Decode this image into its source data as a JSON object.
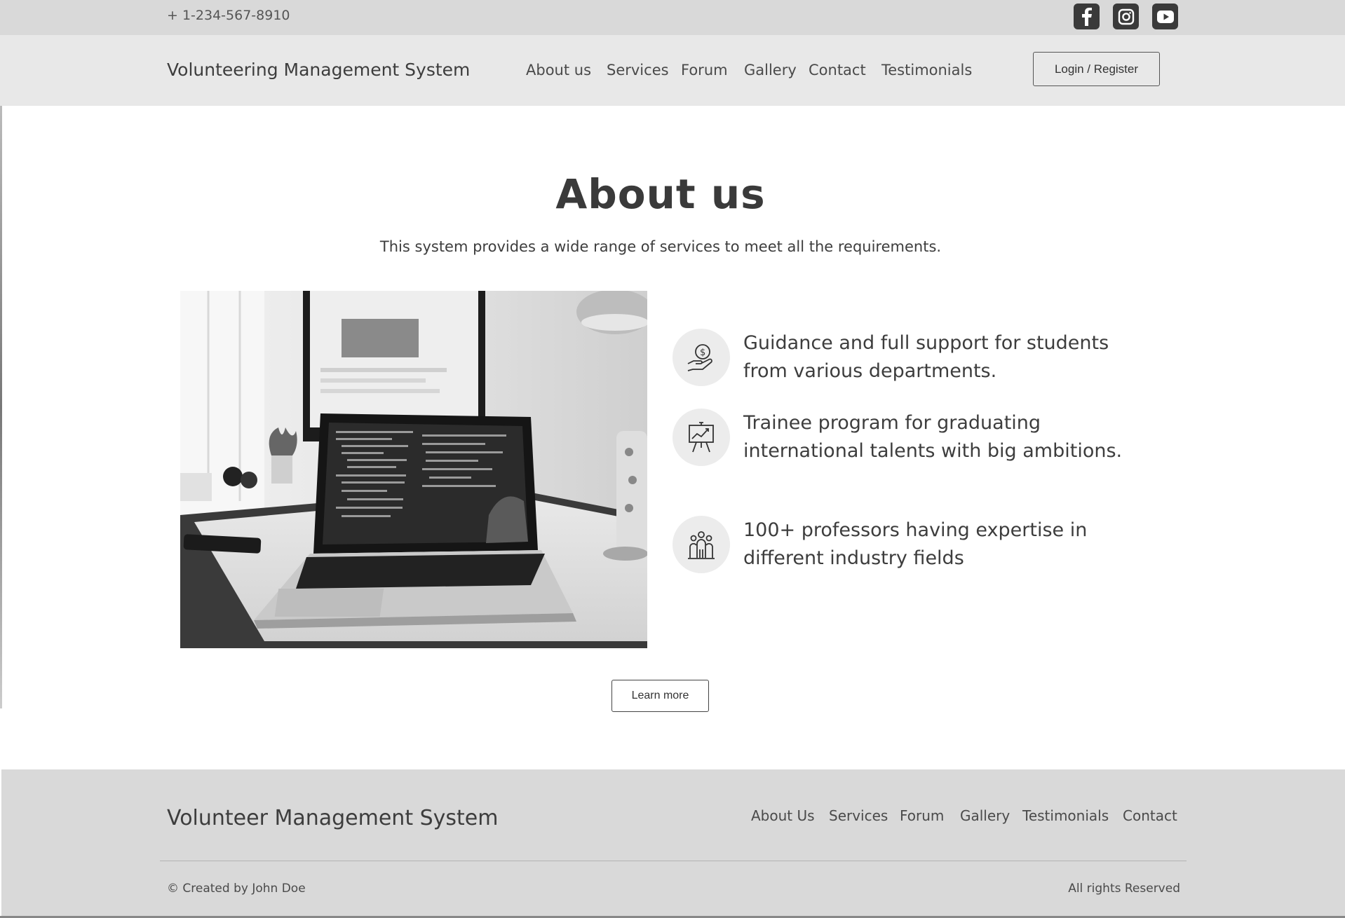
{
  "topbar": {
    "phone": "+ 1-234-567-8910",
    "social": [
      {
        "icon": "facebook-icon"
      },
      {
        "icon": "instagram-icon"
      },
      {
        "icon": "youtube-icon"
      }
    ]
  },
  "header": {
    "brand": "Volunteering Management System",
    "nav": [
      "About us",
      "Services",
      "Forum",
      "Gallery",
      "Contact",
      "Testimonials"
    ],
    "login_label": "Login / Register"
  },
  "about": {
    "title": "About us",
    "subtitle": "This system provides a wide range of services to meet all the requirements.",
    "image": "laptop-desk-photo",
    "features": [
      {
        "icon": "hand-money-icon",
        "text": "Guidance and full support for students from various departments."
      },
      {
        "icon": "presentation-chart-icon",
        "text": "Trainee program for graduating international talents with big ambitions."
      },
      {
        "icon": "people-group-icon",
        "text": "100+ professors having expertise in different industry fields"
      }
    ],
    "learn_more": "Learn more"
  },
  "footer": {
    "brand": "Volunteer Management System",
    "links": [
      "About Us",
      "Services",
      "Forum",
      "Gallery",
      "Testimonials",
      "Contact"
    ],
    "credit": "© Created by John Doe",
    "rights": "All rights Reserved"
  },
  "colors": {
    "topbar": "#d9d9d9",
    "navbar": "#e8e8e8",
    "footer": "#d9d9d9",
    "text": "#3d3d3d",
    "icon_bg": "#3a3a3a"
  }
}
